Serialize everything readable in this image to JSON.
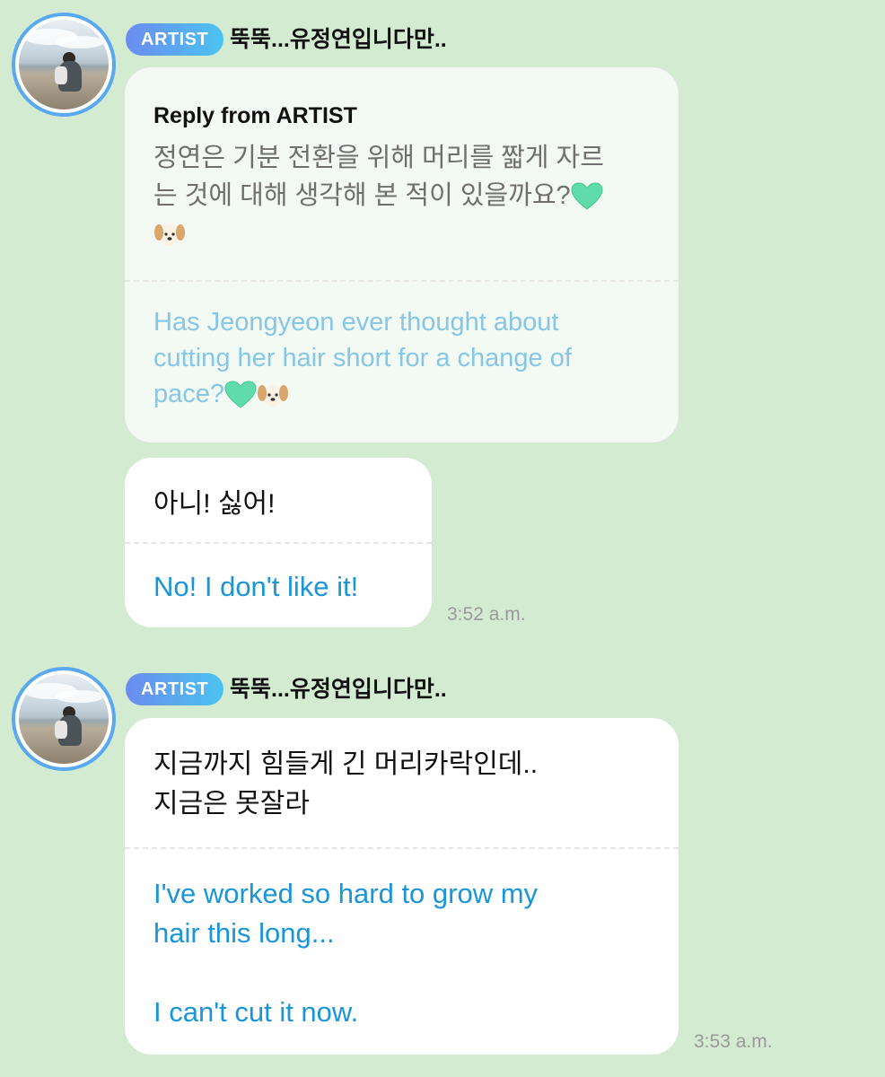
{
  "messages": [
    {
      "badge": "ARTIST",
      "name": "뚝뚝...유정연입니다만..",
      "reply": {
        "title": "Reply from ARTIST",
        "ko_line1": "정연은 기분 전환을 위해 머리를 짧게 자르",
        "ko_line2": "는 것에 대해 생각해 본 적이 있을까요?",
        "en_line1": "Has Jeongyeon ever thought about",
        "en_line2": "cutting her hair short for a change of",
        "en_line3": "pace?"
      },
      "reply_message": {
        "ko": "아니! 싫어!",
        "en": "No! I don't like it!",
        "time": "3:52 a.m."
      }
    },
    {
      "badge": "ARTIST",
      "name": "뚝뚝...유정연입니다만..",
      "message": {
        "ko_line1": "지금까지 힘들게 긴 머리카락인데..",
        "ko_line2": "지금은 못잘라",
        "en_line1": "I've worked so hard to grow my",
        "en_line2": "hair this long...",
        "en_line3": "I can't cut it now.",
        "time": "3:53 a.m."
      }
    }
  ],
  "icons": [
    "green-heart-icon",
    "dog-face-icon"
  ],
  "colors": {
    "background": "#d3ebd1",
    "badge_start": "#6b8cf0",
    "badge_end": "#4bc3f0",
    "translation_blue": "#1996d8"
  }
}
